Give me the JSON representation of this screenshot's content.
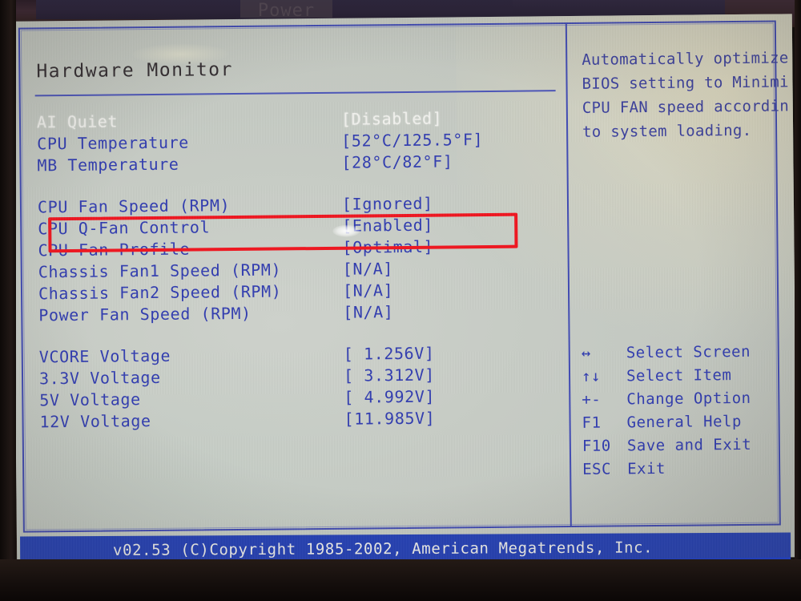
{
  "device": {
    "top_menu_tab": "Power"
  },
  "panel": {
    "title": "Hardware Monitor"
  },
  "rows": [
    {
      "label": "AI Quiet",
      "value": "[Disabled]",
      "highlighted": true
    },
    {
      "label": "CPU Temperature",
      "value": "[52°C/125.5°F]",
      "highlighted": false
    },
    {
      "label": "MB Temperature",
      "value": "[28°C/82°F]",
      "highlighted": false
    },
    {
      "label": "CPU Fan Speed (RPM)",
      "value": "[Ignored]",
      "highlighted": false
    },
    {
      "label": "CPU Q-Fan Control",
      "value": "[Enabled]",
      "highlighted": false
    },
    {
      "label": "CPU Fan Profile",
      "value": "[Optimal]",
      "highlighted": false
    },
    {
      "label": "Chassis Fan1 Speed (RPM)",
      "value": "[N/A]",
      "highlighted": false
    },
    {
      "label": "Chassis Fan2 Speed (RPM)",
      "value": "[N/A]",
      "highlighted": false
    },
    {
      "label": "Power Fan Speed (RPM)",
      "value": "[N/A]",
      "highlighted": false
    },
    {
      "label": "VCORE  Voltage",
      "value": "[ 1.256V]",
      "highlighted": false
    },
    {
      "label": "3.3V  Voltage",
      "value": "[ 3.312V]",
      "highlighted": false
    },
    {
      "label": "5V  Voltage",
      "value": "[ 4.992V]",
      "highlighted": false
    },
    {
      "label": "12V  Voltage",
      "value": "[11.985V]",
      "highlighted": false
    }
  ],
  "help": {
    "lines": [
      "Automatically optimize",
      "BIOS setting to Minimi",
      "CPU FAN speed accordin",
      "to system loading."
    ]
  },
  "keys": [
    {
      "key": "↔",
      "desc": "Select Screen"
    },
    {
      "key": "↑↓",
      "desc": "Select Item"
    },
    {
      "key": "+-",
      "desc": "Change Option"
    },
    {
      "key": "F1",
      "desc": "General Help"
    },
    {
      "key": "F10",
      "desc": "Save and Exit"
    },
    {
      "key": "ESC",
      "desc": "Exit"
    }
  ],
  "footer": {
    "text": "v02.53 (C)Copyright 1985-2002, American Megatrends, Inc."
  },
  "annotation": {
    "color": "#f0141e",
    "target_row_label": "CPU Fan Speed (RPM)"
  },
  "colors": {
    "screen_bg": "#c7ccc5",
    "text_blue": "#2f3bb0",
    "text_white": "#f2f2ee",
    "title_dark": "#312b2f",
    "border_blue": "#3f49b4",
    "footer_blue": "#2340b8",
    "annotation_red": "#f0141e"
  }
}
